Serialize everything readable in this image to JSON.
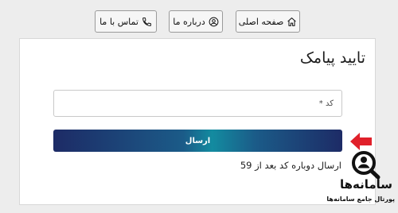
{
  "nav": {
    "contact_label": "تماس با ما",
    "about_label": "درباره ما",
    "home_label": "صفحه اصلی"
  },
  "icons": {
    "contact": "phone-icon",
    "about": "user-circle-icon",
    "home": "home-icon",
    "pointer": "arrow-left-icon"
  },
  "form": {
    "title": "تایید پیامک",
    "code_placeholder": "کد *",
    "code_value": "",
    "submit_label": "ارسال",
    "resend_text": "ارسال دوباره کد بعد از 59"
  },
  "watermark": {
    "name": "سامانه‌ها",
    "tagline": "پورتال جامع سامانه‌ها"
  },
  "colors": {
    "button_dark": "#1d2b66",
    "button_light": "#138ba0",
    "arrow": "#e0202a",
    "background": "#ededed",
    "card": "#ffffff"
  }
}
